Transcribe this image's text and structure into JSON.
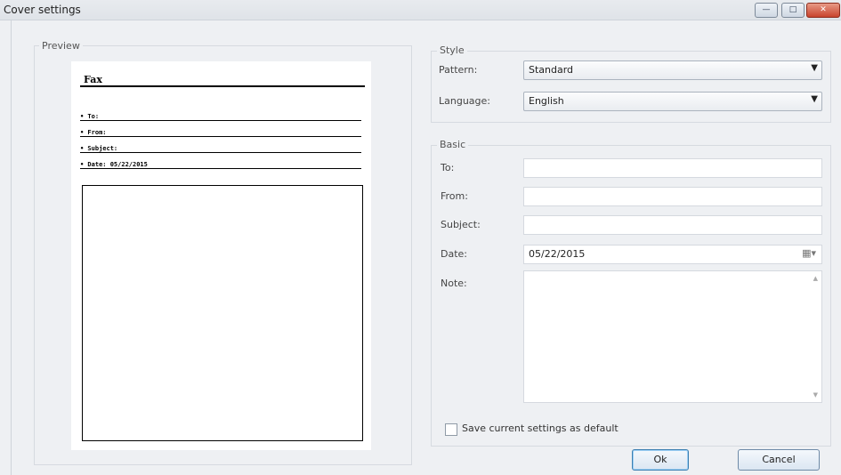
{
  "window": {
    "title": "Cover settings",
    "controls": {
      "minimize": "—",
      "maximize": "□",
      "close": "✕"
    }
  },
  "preview": {
    "group_label": "Preview",
    "doc_title": "Fax",
    "fields": [
      "• To:",
      "• From:",
      "• Subject:",
      "• Date:  05/22/2015"
    ]
  },
  "style": {
    "group_label": "Style",
    "pattern_label": "Pattern:",
    "pattern_value": "Standard",
    "language_label": "Language:",
    "language_value": "English"
  },
  "basic": {
    "group_label": "Basic",
    "to_label": "To:",
    "to_value": "",
    "from_label": "From:",
    "from_value": "",
    "subject_label": "Subject:",
    "subject_value": "",
    "date_label": "Date:",
    "date_value": "05/22/2015",
    "note_label": "Note:",
    "note_value": ""
  },
  "options": {
    "save_default_label": "Save current settings as default",
    "save_default_checked": false
  },
  "buttons": {
    "ok": "Ok",
    "cancel": "Cancel"
  },
  "icons": {
    "dropdown": "▼",
    "calendar": "▦▾",
    "scroll_up": "▲",
    "scroll_down": "▼"
  }
}
